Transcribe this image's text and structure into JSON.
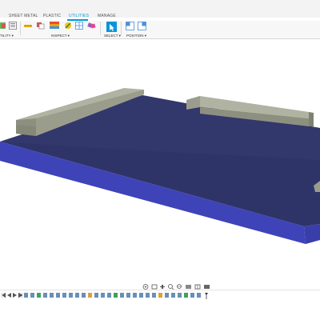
{
  "ribbon": {
    "tabs": [
      {
        "label": "SHEET METAL",
        "active": false
      },
      {
        "label": "PLASTIC",
        "active": false
      },
      {
        "label": "UTILITIES",
        "active": true
      },
      {
        "label": "MANAGE",
        "active": false
      }
    ],
    "groups": {
      "utility": "TILITY ▾",
      "inspect": "INSPECT ▾",
      "select": "SELECT ▾",
      "position": "POSITION ▾"
    },
    "accent_color": "#0696d7"
  },
  "viewport": {
    "background": "#ffffff",
    "plate_color": "#3f43b8",
    "plate_top_color": "#2f3468",
    "bracket_color": "#9a9d8c"
  },
  "navigation_bar": {
    "icons": [
      "orbit-icon",
      "look-at-icon",
      "pan-icon",
      "zoom-icon",
      "fit-icon",
      "display-settings-icon",
      "grid-settings-icon",
      "viewports-icon"
    ]
  },
  "timeline": {
    "icons": [
      "timeline-start-icon",
      "timeline-prev-icon",
      "timeline-play-icon",
      "timeline-next-icon",
      "timeline-end-icon"
    ]
  }
}
